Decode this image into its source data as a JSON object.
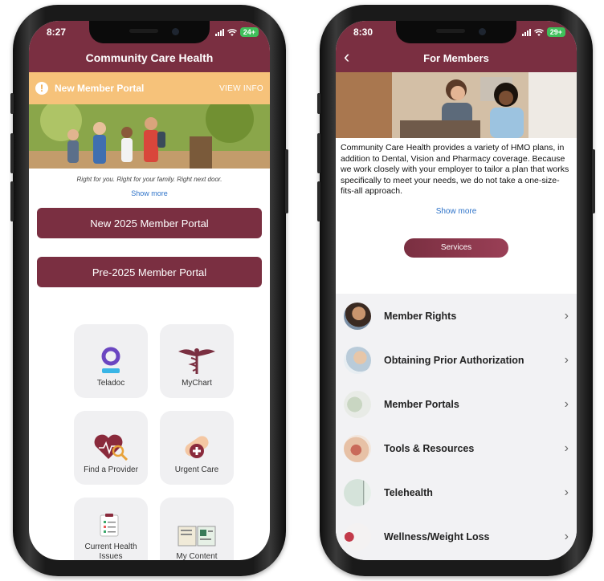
{
  "left_phone": {
    "status": {
      "time": "8:27",
      "battery": "24+"
    },
    "header": {
      "title": "Community Care Health"
    },
    "banner": {
      "message": "New Member Portal",
      "action": "VIEW INFO",
      "icon": "warning-icon"
    },
    "tagline": "Right for you. Right for your family. Right next door.",
    "show_more": "Show more",
    "buttons": {
      "new_portal": "New 2025 Member Portal",
      "pre_portal": "Pre-2025 Member Portal"
    },
    "tiles": [
      {
        "label": "Teladoc",
        "icon": "teladoc-icon"
      },
      {
        "label": "MyChart",
        "icon": "caduceus-icon"
      },
      {
        "label": "Find a Provider",
        "icon": "heart-search-icon"
      },
      {
        "label": "Urgent Care",
        "icon": "bandage-icon"
      },
      {
        "label": "Current Health Issues",
        "icon": "checklist-icon"
      },
      {
        "label": "My Content",
        "icon": "book-icon"
      }
    ]
  },
  "right_phone": {
    "status": {
      "time": "8:30",
      "battery": "29+"
    },
    "header": {
      "title": "For Members",
      "back_icon": "chevron-left-icon"
    },
    "description": "Community Care Health provides a variety of HMO plans, in addition to Dental, Vision and Pharmacy coverage. Because we work closely with your employer to tailor a plan that works specifically to meet your needs, we do not take a one-size-fits-all approach.",
    "show_more": "Show more",
    "services_button": "Services",
    "list": [
      {
        "label": "Member Rights"
      },
      {
        "label": "Obtaining Prior Authorization"
      },
      {
        "label": "Member Portals"
      },
      {
        "label": "Tools & Resources"
      },
      {
        "label": "Telehealth"
      },
      {
        "label": "Wellness/Weight Loss"
      }
    ]
  },
  "colors": {
    "brand": "#7a2f41",
    "banner": "#f6c27a",
    "link": "#2e73c9",
    "battery": "#3fbf5a"
  }
}
